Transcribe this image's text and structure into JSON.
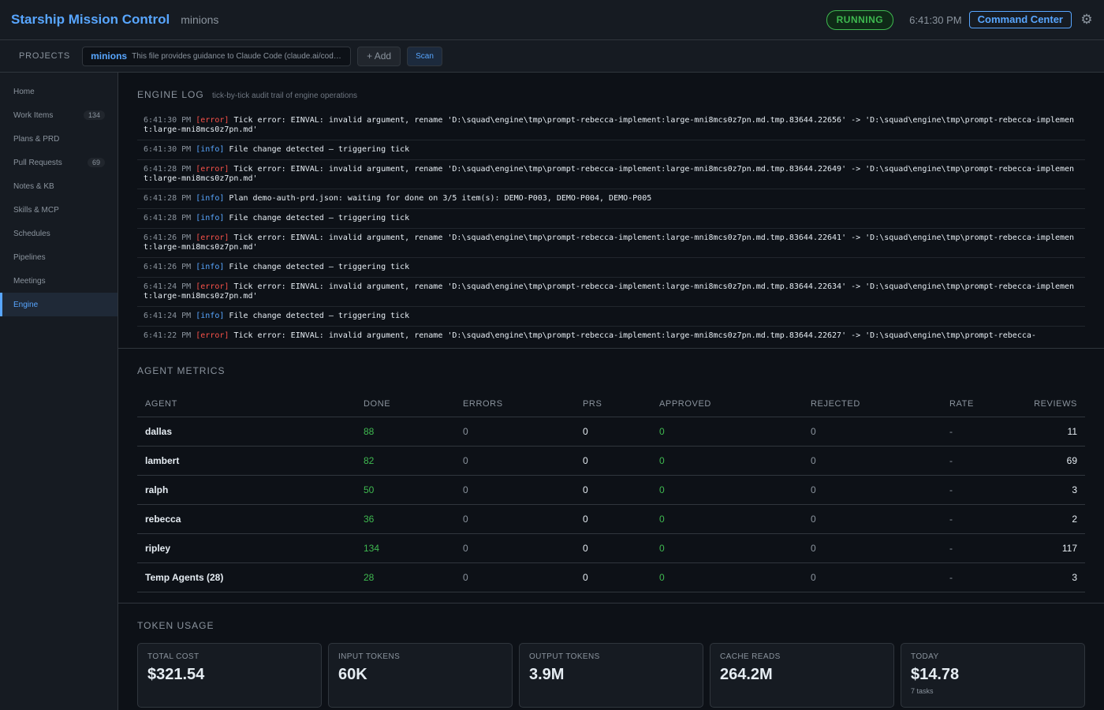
{
  "header": {
    "title": "Starship Mission Control",
    "subtitle": "minions",
    "status": "RUNNING",
    "time": "6:41:30 PM",
    "command_center": "Command Center",
    "settings_icon": "gear-icon"
  },
  "projects_bar": {
    "label": "PROJECTS",
    "project_name": "minions",
    "project_desc": "This file provides guidance to Claude Code (claude.ai/code) when working with code in this repository.",
    "add": "+ Add",
    "scan": "Scan"
  },
  "sidebar": {
    "items": [
      {
        "label": "Home",
        "count": ""
      },
      {
        "label": "Work Items",
        "count": "134"
      },
      {
        "label": "Plans & PRD",
        "count": ""
      },
      {
        "label": "Pull Requests",
        "count": "69"
      },
      {
        "label": "Notes & KB",
        "count": ""
      },
      {
        "label": "Skills & MCP",
        "count": ""
      },
      {
        "label": "Schedules",
        "count": ""
      },
      {
        "label": "Pipelines",
        "count": ""
      },
      {
        "label": "Meetings",
        "count": ""
      },
      {
        "label": "Engine",
        "count": ""
      }
    ]
  },
  "engine_log": {
    "title": "ENGINE LOG",
    "hint": "tick-by-tick audit trail of engine operations",
    "entries": [
      {
        "time": "6:41:30 PM",
        "level": "[error]",
        "message": "Tick error: EINVAL: invalid argument, rename 'D:\\squad\\engine\\tmp\\prompt-rebecca-implement:large-mni8mcs0z7pn.md.tmp.83644.22656' -> 'D:\\squad\\engine\\tmp\\prompt-rebecca-implement:large-mni8mcs0z7pn.md'"
      },
      {
        "time": "6:41:30 PM",
        "level": "[info]",
        "message": "File change detected — triggering tick"
      },
      {
        "time": "6:41:28 PM",
        "level": "[error]",
        "message": "Tick error: EINVAL: invalid argument, rename 'D:\\squad\\engine\\tmp\\prompt-rebecca-implement:large-mni8mcs0z7pn.md.tmp.83644.22649' -> 'D:\\squad\\engine\\tmp\\prompt-rebecca-implement:large-mni8mcs0z7pn.md'"
      },
      {
        "time": "6:41:28 PM",
        "level": "[info]",
        "message": "Plan demo-auth-prd.json: waiting for done on 3/5 item(s): DEMO-P003, DEMO-P004, DEMO-P005"
      },
      {
        "time": "6:41:28 PM",
        "level": "[info]",
        "message": "File change detected — triggering tick"
      },
      {
        "time": "6:41:26 PM",
        "level": "[error]",
        "message": "Tick error: EINVAL: invalid argument, rename 'D:\\squad\\engine\\tmp\\prompt-rebecca-implement:large-mni8mcs0z7pn.md.tmp.83644.22641' -> 'D:\\squad\\engine\\tmp\\prompt-rebecca-implement:large-mni8mcs0z7pn.md'"
      },
      {
        "time": "6:41:26 PM",
        "level": "[info]",
        "message": "File change detected — triggering tick"
      },
      {
        "time": "6:41:24 PM",
        "level": "[error]",
        "message": "Tick error: EINVAL: invalid argument, rename 'D:\\squad\\engine\\tmp\\prompt-rebecca-implement:large-mni8mcs0z7pn.md.tmp.83644.22634' -> 'D:\\squad\\engine\\tmp\\prompt-rebecca-implement:large-mni8mcs0z7pn.md'"
      },
      {
        "time": "6:41:24 PM",
        "level": "[info]",
        "message": "File change detected — triggering tick"
      },
      {
        "time": "6:41:22 PM",
        "level": "[error]",
        "message": "Tick error: EINVAL: invalid argument, rename 'D:\\squad\\engine\\tmp\\prompt-rebecca-implement:large-mni8mcs0z7pn.md.tmp.83644.22627' -> 'D:\\squad\\engine\\tmp\\prompt-rebecca-"
      }
    ]
  },
  "agent_metrics": {
    "title": "AGENT METRICS",
    "columns": [
      "AGENT",
      "DONE",
      "ERRORS",
      "PRS",
      "APPROVED",
      "REJECTED",
      "RATE",
      "REVIEWS"
    ],
    "rows": [
      {
        "agent": "dallas",
        "done": "88",
        "errors": "0",
        "prs": "0",
        "approved": "0",
        "rejected": "0",
        "rate": "-",
        "reviews": "11"
      },
      {
        "agent": "lambert",
        "done": "82",
        "errors": "0",
        "prs": "0",
        "approved": "0",
        "rejected": "0",
        "rate": "-",
        "reviews": "69"
      },
      {
        "agent": "ralph",
        "done": "50",
        "errors": "0",
        "prs": "0",
        "approved": "0",
        "rejected": "0",
        "rate": "-",
        "reviews": "3"
      },
      {
        "agent": "rebecca",
        "done": "36",
        "errors": "0",
        "prs": "0",
        "approved": "0",
        "rejected": "0",
        "rate": "-",
        "reviews": "2"
      },
      {
        "agent": "ripley",
        "done": "134",
        "errors": "0",
        "prs": "0",
        "approved": "0",
        "rejected": "0",
        "rate": "-",
        "reviews": "117"
      },
      {
        "agent": "Temp Agents (28)",
        "done": "28",
        "errors": "0",
        "prs": "0",
        "approved": "0",
        "rejected": "0",
        "rate": "-",
        "reviews": "3"
      }
    ]
  },
  "token_usage": {
    "title": "TOKEN USAGE",
    "cards": [
      {
        "label": "TOTAL COST",
        "value": "$321.54",
        "sub": ""
      },
      {
        "label": "INPUT TOKENS",
        "value": "60K",
        "sub": ""
      },
      {
        "label": "OUTPUT TOKENS",
        "value": "3.9M",
        "sub": ""
      },
      {
        "label": "CACHE READS",
        "value": "264.2M",
        "sub": ""
      },
      {
        "label": "TODAY",
        "value": "$14.78",
        "sub": "7 tasks"
      }
    ]
  }
}
